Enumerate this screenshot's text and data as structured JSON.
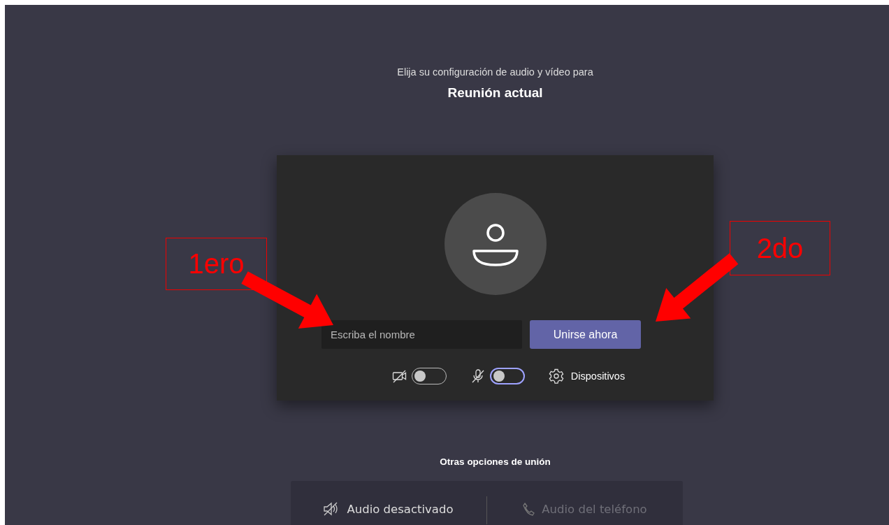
{
  "prompt": {
    "subtitle": "Elija su configuración de audio y vídeo para",
    "title": "Reunión actual"
  },
  "join_card": {
    "name_field": {
      "placeholder": "Escriba el nombre"
    },
    "join_button": "Unirse ahora",
    "toggles": [
      {
        "kind": "camera",
        "on": false,
        "color": "#bbbbbb"
      },
      {
        "kind": "microphone",
        "on": false,
        "color": "#9ea2ff"
      }
    ],
    "devices_button": "Dispositivos"
  },
  "other_options": {
    "heading": "Otras opciones de unión",
    "options": [
      {
        "kind": "audio-off",
        "label": "Audio desactivado",
        "disabled": false
      },
      {
        "kind": "phone",
        "label": "Audio del teléfono",
        "disabled": true
      }
    ]
  },
  "annotations": [
    {
      "label": "1ero"
    },
    {
      "label": "2do"
    }
  ]
}
